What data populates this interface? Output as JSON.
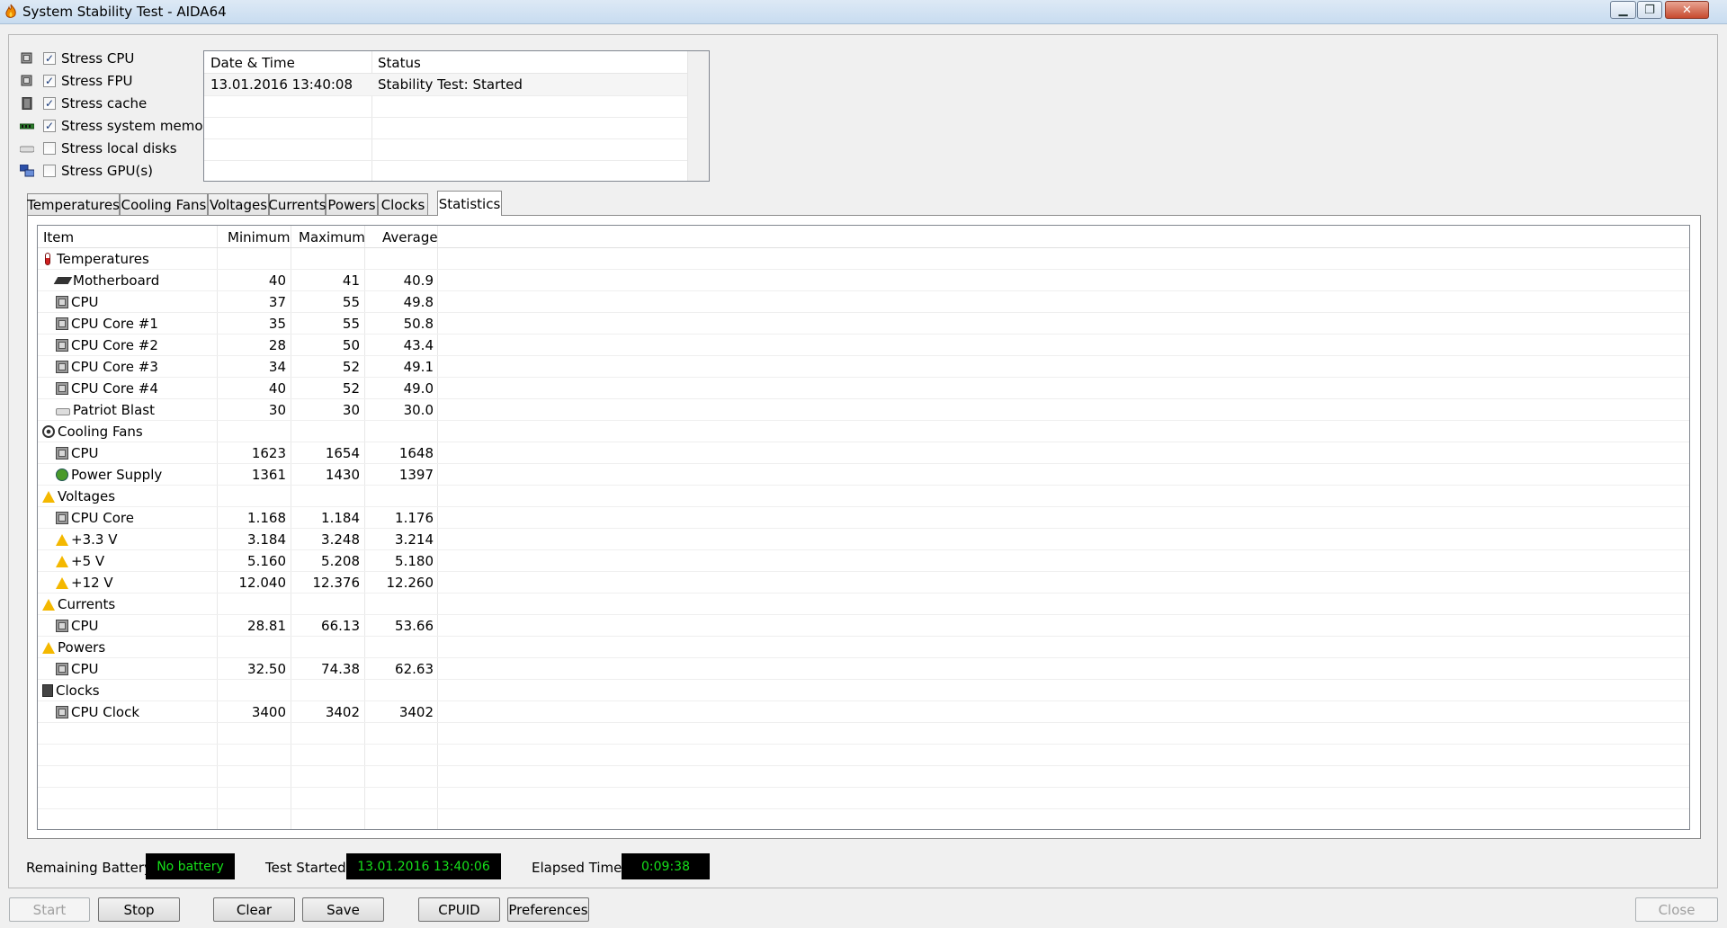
{
  "window": {
    "title": "System Stability Test - AIDA64",
    "minimize_icon": "minimize-icon",
    "maximize_icon": "restore-icon",
    "close_icon": "close-icon"
  },
  "stress_options": [
    {
      "label": "Stress CPU",
      "checked": true,
      "icon": "cpu-icon"
    },
    {
      "label": "Stress FPU",
      "checked": true,
      "icon": "fpu-icon"
    },
    {
      "label": "Stress cache",
      "checked": true,
      "icon": "cache-icon"
    },
    {
      "label": "Stress system memory",
      "checked": true,
      "icon": "memory-icon"
    },
    {
      "label": "Stress local disks",
      "checked": false,
      "icon": "disk-icon"
    },
    {
      "label": "Stress GPU(s)",
      "checked": false,
      "icon": "gpu-icon"
    }
  ],
  "log": {
    "headers": [
      "Date & Time",
      "Status"
    ],
    "rows": [
      {
        "datetime": "13.01.2016 13:40:08",
        "status": "Stability Test: Started"
      }
    ]
  },
  "tabs": [
    "Temperatures",
    "Cooling Fans",
    "Voltages",
    "Currents",
    "Powers",
    "Clocks",
    "Statistics"
  ],
  "active_tab": "Statistics",
  "statistics": {
    "headers": [
      "Item",
      "Minimum",
      "Maximum",
      "Average"
    ],
    "rows": [
      {
        "item": "Temperatures",
        "group": true,
        "icon": "thermometer-icon",
        "min": "",
        "max": "",
        "avg": ""
      },
      {
        "item": "Motherboard",
        "group": false,
        "icon": "motherboard-icon",
        "min": "40",
        "max": "41",
        "avg": "40.9"
      },
      {
        "item": "CPU",
        "group": false,
        "icon": "chip-icon",
        "min": "37",
        "max": "55",
        "avg": "49.8"
      },
      {
        "item": "CPU Core #1",
        "group": false,
        "icon": "chip-icon",
        "min": "35",
        "max": "55",
        "avg": "50.8"
      },
      {
        "item": "CPU Core #2",
        "group": false,
        "icon": "chip-icon",
        "min": "28",
        "max": "50",
        "avg": "43.4"
      },
      {
        "item": "CPU Core #3",
        "group": false,
        "icon": "chip-icon",
        "min": "34",
        "max": "52",
        "avg": "49.1"
      },
      {
        "item": "CPU Core #4",
        "group": false,
        "icon": "chip-icon",
        "min": "40",
        "max": "52",
        "avg": "49.0"
      },
      {
        "item": "Patriot Blast",
        "group": false,
        "icon": "disk-icon",
        "min": "30",
        "max": "30",
        "avg": "30.0"
      },
      {
        "item": "Cooling Fans",
        "group": true,
        "icon": "fan-icon",
        "min": "",
        "max": "",
        "avg": ""
      },
      {
        "item": "CPU",
        "group": false,
        "icon": "chip-icon",
        "min": "1623",
        "max": "1654",
        "avg": "1648"
      },
      {
        "item": "Power Supply",
        "group": false,
        "icon": "power-supply-icon",
        "min": "1361",
        "max": "1430",
        "avg": "1397"
      },
      {
        "item": "Voltages",
        "group": true,
        "icon": "warning-icon",
        "min": "",
        "max": "",
        "avg": ""
      },
      {
        "item": "CPU Core",
        "group": false,
        "icon": "chip-icon",
        "min": "1.168",
        "max": "1.184",
        "avg": "1.176"
      },
      {
        "item": "+3.3 V",
        "group": false,
        "icon": "warning-icon",
        "min": "3.184",
        "max": "3.248",
        "avg": "3.214"
      },
      {
        "item": "+5 V",
        "group": false,
        "icon": "warning-icon",
        "min": "5.160",
        "max": "5.208",
        "avg": "5.180"
      },
      {
        "item": "+12 V",
        "group": false,
        "icon": "warning-icon",
        "min": "12.040",
        "max": "12.376",
        "avg": "12.260"
      },
      {
        "item": "Currents",
        "group": true,
        "icon": "warning-icon",
        "min": "",
        "max": "",
        "avg": ""
      },
      {
        "item": "CPU",
        "group": false,
        "icon": "chip-icon",
        "min": "28.81",
        "max": "66.13",
        "avg": "53.66"
      },
      {
        "item": "Powers",
        "group": true,
        "icon": "warning-icon",
        "min": "",
        "max": "",
        "avg": ""
      },
      {
        "item": "CPU",
        "group": false,
        "icon": "chip-icon",
        "min": "32.50",
        "max": "74.38",
        "avg": "62.63"
      },
      {
        "item": "Clocks",
        "group": true,
        "icon": "clock-icon",
        "min": "",
        "max": "",
        "avg": ""
      },
      {
        "item": "CPU Clock",
        "group": false,
        "icon": "chip-icon",
        "min": "3400",
        "max": "3402",
        "avg": "3402"
      }
    ]
  },
  "status_bar": {
    "battery_label": "Remaining Battery:",
    "battery_value": "No battery",
    "started_label": "Test Started:",
    "started_value": "13.01.2016 13:40:06",
    "elapsed_label": "Elapsed Time:",
    "elapsed_value": "0:09:38",
    "value_color": "#16e01a"
  },
  "buttons": {
    "start": "Start",
    "stop": "Stop",
    "clear": "Clear",
    "save": "Save",
    "cpuid": "CPUID",
    "preferences": "Preferences",
    "close": "Close"
  }
}
